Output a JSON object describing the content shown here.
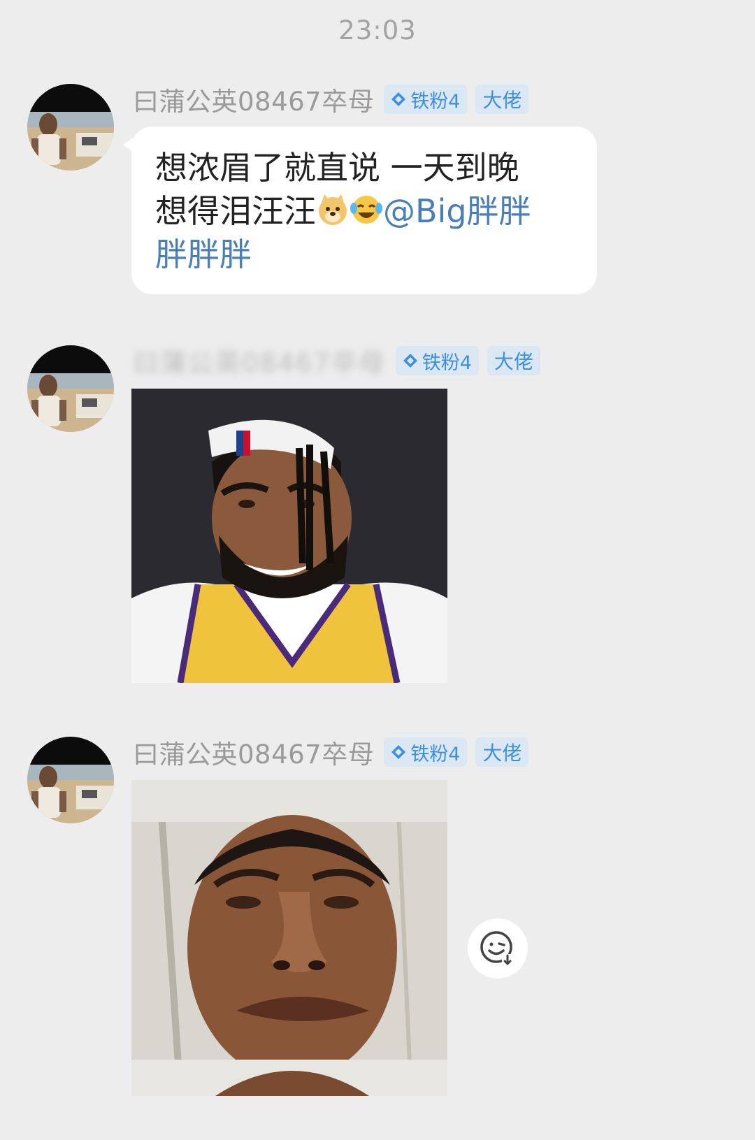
{
  "chat": {
    "timestamp": "23:03",
    "messages": [
      {
        "username": "曰蒲公英08467卒母",
        "fan_badge": "铁粉4",
        "role_badge": "大佬",
        "text_line_1": "想浓眉了就直说 一天到晚",
        "text_line_2": "想得泪汪汪",
        "mention_part_1": "@Big胖胖",
        "mention_part_2": "胖胖胖"
      },
      {
        "username": "曰蒲公英08467卒母",
        "fan_badge": "铁粉4",
        "role_badge": "大佬"
      },
      {
        "username": "曰蒲公英08467卒母",
        "fan_badge": "铁粉4",
        "role_badge": "大佬"
      }
    ]
  },
  "icons": {
    "avatar": "avatar-photo",
    "fan_badge_icon": "diamond-icon",
    "emoji_1": "doge-emoji-icon",
    "emoji_2": "laugh-cry-emoji-icon",
    "add_sticker": "add-sticker-icon"
  },
  "colors": {
    "background": "#ededed",
    "bubble": "#ffffff",
    "mention": "#4a7fb5",
    "badge_bg": "#dbe8f4",
    "badge_text": "#3d8fdc"
  }
}
